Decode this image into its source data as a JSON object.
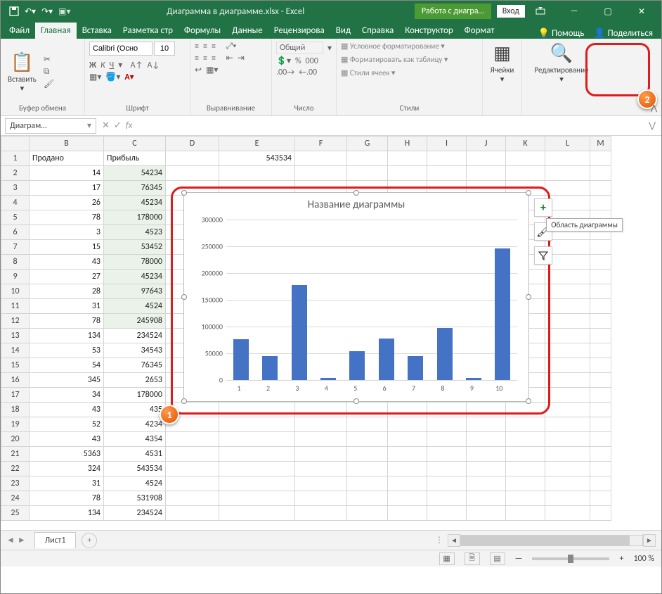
{
  "app": {
    "title": "Диаграмма в диаграмме.xlsx  -  Excel",
    "chart_tools": "Работа с диагра…",
    "signin": "Вход"
  },
  "tabs": {
    "file": "Файл",
    "home": "Главная",
    "insert": "Вставка",
    "layout": "Разметка стр",
    "formulas": "Формулы",
    "data": "Данные",
    "review": "Рецензирова",
    "view": "Вид",
    "help": "Справка",
    "design": "Конструктор",
    "format": "Формат",
    "help_btn": "Помощь",
    "share": "Поделиться"
  },
  "ribbon": {
    "clipboard": {
      "paste": "Вставить",
      "label": "Буфер обмена"
    },
    "font": {
      "name": "Calibri (Осно",
      "size": "10",
      "label": "Шрифт"
    },
    "alignment": {
      "label": "Выравнивание"
    },
    "number": {
      "format": "Общий",
      "label": "Число"
    },
    "styles": {
      "cond": "Условное форматирование",
      "table": "Форматировать как таблицу",
      "cell": "Стили ячеек",
      "label": "Стили"
    },
    "cells": {
      "label": "Ячейки"
    },
    "editing": {
      "label": "Редактирование"
    }
  },
  "fx": {
    "namebox": "Диаграм…"
  },
  "sheet": {
    "cols": [
      "",
      "B",
      "C",
      "D",
      "E",
      "F",
      "G",
      "H",
      "I",
      "J",
      "K",
      "L",
      "M"
    ],
    "h1": "Продано",
    "h2": "Прибыль",
    "e1": "543534",
    "rows": [
      {
        "n": 1,
        "b": "Продано",
        "c": "Прибыль"
      },
      {
        "n": 2,
        "b": "14",
        "c": "54234"
      },
      {
        "n": 3,
        "b": "17",
        "c": "76345"
      },
      {
        "n": 4,
        "b": "26",
        "c": "45234"
      },
      {
        "n": 5,
        "b": "78",
        "c": "178000"
      },
      {
        "n": 6,
        "b": "3",
        "c": "4523"
      },
      {
        "n": 7,
        "b": "15",
        "c": "53452"
      },
      {
        "n": 8,
        "b": "43",
        "c": "78000"
      },
      {
        "n": 9,
        "b": "27",
        "c": "45234"
      },
      {
        "n": 10,
        "b": "28",
        "c": "97643"
      },
      {
        "n": 11,
        "b": "31",
        "c": "4524"
      },
      {
        "n": 12,
        "b": "78",
        "c": "245908"
      },
      {
        "n": 13,
        "b": "134",
        "c": "234524"
      },
      {
        "n": 14,
        "b": "53",
        "c": "34543"
      },
      {
        "n": 15,
        "b": "54",
        "c": "76345"
      },
      {
        "n": 16,
        "b": "345",
        "c": "2653"
      },
      {
        "n": 17,
        "b": "34",
        "c": "178000"
      },
      {
        "n": 18,
        "b": "43",
        "c": "435"
      },
      {
        "n": 19,
        "b": "52",
        "c": "4234"
      },
      {
        "n": 20,
        "b": "43",
        "c": "4354"
      },
      {
        "n": 21,
        "b": "5363",
        "c": "4531"
      },
      {
        "n": 22,
        "b": "324",
        "c": "543534"
      },
      {
        "n": 23,
        "b": "31",
        "c": "4524"
      },
      {
        "n": 24,
        "b": "78",
        "c": "531908"
      },
      {
        "n": 25,
        "b": "134",
        "c": "234524"
      }
    ],
    "tab": "Лист1"
  },
  "chart": {
    "title": "Название диаграммы",
    "tooltip": "Область диаграммы"
  },
  "status": {
    "zoom": "100 %"
  },
  "callouts": {
    "one": "1",
    "two": "2"
  },
  "chart_data": {
    "type": "bar",
    "title": "Название диаграммы",
    "xlabel": "",
    "ylabel": "",
    "ylim": [
      0,
      300000
    ],
    "yticks": [
      0,
      50000,
      100000,
      150000,
      200000,
      250000,
      300000
    ],
    "categories": [
      "1",
      "2",
      "3",
      "4",
      "5",
      "6",
      "7",
      "8",
      "9",
      "10"
    ],
    "values": [
      76345,
      45234,
      178000,
      4523,
      53452,
      78000,
      45234,
      97643,
      4524,
      245908
    ]
  }
}
